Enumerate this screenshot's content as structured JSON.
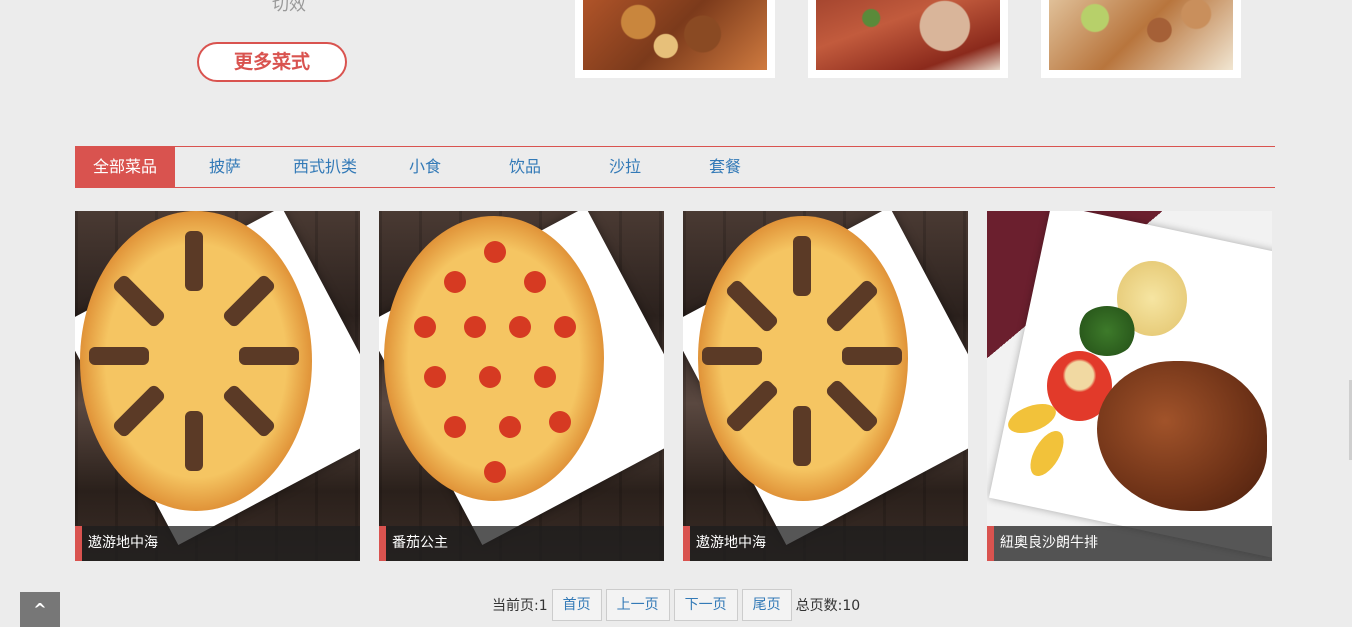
{
  "hero": {
    "more_button": "更多菜式"
  },
  "top_photos": [
    {
      "icon": "dish-photo-braised"
    },
    {
      "icon": "dish-photo-saucy"
    },
    {
      "icon": "dish-photo-diced"
    }
  ],
  "tabs": [
    {
      "label": "全部菜品",
      "active": true
    },
    {
      "label": "披萨",
      "active": false
    },
    {
      "label": "西式扒类",
      "active": false
    },
    {
      "label": "小食",
      "active": false
    },
    {
      "label": "饮品",
      "active": false
    },
    {
      "label": "沙拉",
      "active": false
    },
    {
      "label": "套餐",
      "active": false
    }
  ],
  "cards": [
    {
      "title": "遨游地中海",
      "image": "pizza-seafood-photo"
    },
    {
      "title": "番茄公主",
      "image": "pizza-tomato-photo"
    },
    {
      "title": "遨游地中海",
      "image": "pizza-seafood-photo"
    },
    {
      "title": "紐奧良沙朗牛排",
      "image": "steak-photo"
    }
  ],
  "pager": {
    "current_label": "当前页:1",
    "first": "首页",
    "prev": "上一页",
    "next": "下一页",
    "last": "尾页",
    "total_label": "总页数:10"
  },
  "back_to_top": "^",
  "colors": {
    "accent": "#d9534f",
    "link": "#337ab7"
  }
}
